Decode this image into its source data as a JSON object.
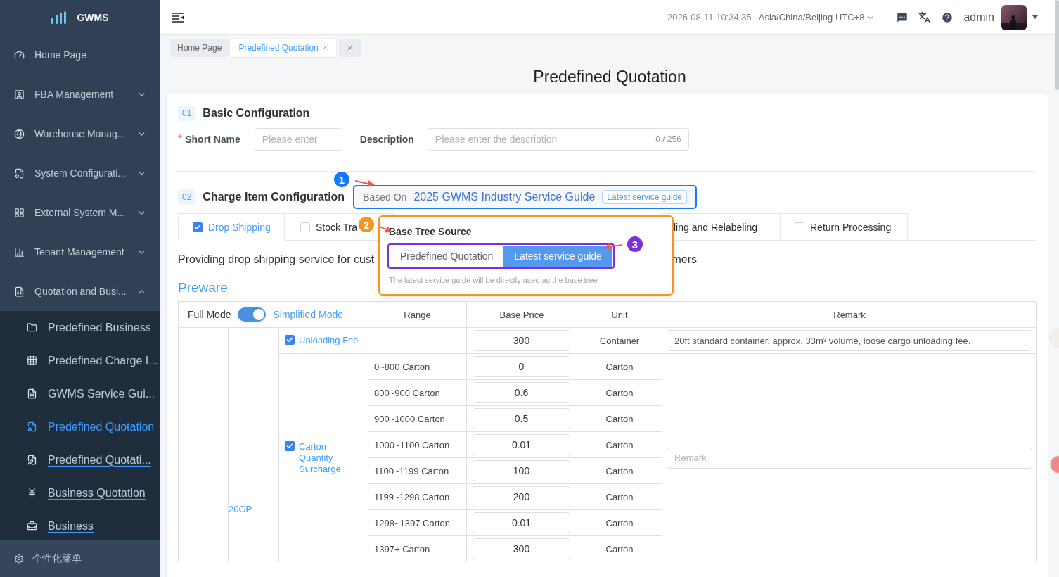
{
  "sidebar": {
    "logo": "GWMS",
    "items": [
      {
        "label": "Home Page",
        "kind": "link"
      },
      {
        "label": "FBA Management",
        "kind": "group",
        "expanded": false
      },
      {
        "label": "Warehouse Manag...",
        "kind": "group",
        "expanded": false
      },
      {
        "label": "System Configurati...",
        "kind": "group",
        "expanded": false
      },
      {
        "label": "External System M...",
        "kind": "group",
        "expanded": false
      },
      {
        "label": "Tenant Management",
        "kind": "group",
        "expanded": false
      },
      {
        "label": "Quotation and Busi...",
        "kind": "group",
        "expanded": true,
        "children": [
          {
            "label": "Predefined Business",
            "selected": false
          },
          {
            "label": "Predefined Charge I...",
            "selected": false
          },
          {
            "label": "GWMS Service Gui...",
            "selected": false
          },
          {
            "label": "Predefined Quotation",
            "selected": true
          },
          {
            "label": "Predefined Quotati...",
            "selected": false
          },
          {
            "label": "Business Quotation",
            "selected": false
          },
          {
            "label": "Business",
            "selected": false
          }
        ]
      }
    ],
    "footer": "个性化菜单"
  },
  "header": {
    "datetime": "2026-08-11 10:34:35",
    "timezone": "Asia/China/Beijing UTC+8",
    "user": "admin"
  },
  "page_tabs": [
    {
      "label": "Home Page",
      "selected": false,
      "closable": false
    },
    {
      "label": "Predefined Quotation",
      "selected": true,
      "closable": true
    }
  ],
  "page_title": "Predefined Quotation",
  "basic": {
    "number": "01",
    "title": "Basic Configuration",
    "short_name": {
      "label": "Short Name",
      "required_mark": "*",
      "placeholder": "Please enter"
    },
    "description": {
      "label": "Description",
      "placeholder": "Please enter the description",
      "counter": "0 / 256"
    }
  },
  "charge": {
    "number": "02",
    "title": "Charge Item Configuration",
    "based_on_label": "Based On",
    "based_on": "2025 GWMS Industry Service Guide",
    "based_on_tag": "Latest service guide",
    "tabs": [
      {
        "label": "Drop Shipping",
        "selected": true,
        "checked": true
      },
      {
        "label": "Stock Tra",
        "selected": false,
        "checked": false
      },
      {
        "label": "ling and Relabeling",
        "selected": false
      },
      {
        "label": "Return Processing",
        "selected": false,
        "checked": false
      }
    ],
    "description_start": "Providing drop shipping service for cust",
    "description_end": "mers",
    "popover": {
      "title": "Base Tree Source",
      "options": [
        {
          "label": "Predefined Quotation",
          "selected": false
        },
        {
          "label": "Latest service guide",
          "selected": true
        }
      ],
      "hint": "The latest service guide will be directly used as the base tree"
    },
    "annotations": [
      "1",
      "2",
      "3"
    ]
  },
  "section": "Preware",
  "table": {
    "mode_left": "Full Mode",
    "mode_right": "Simplified Mode",
    "mode_on": true,
    "columns": [
      "Range",
      "Base Price",
      "Unit",
      "Remark"
    ],
    "container": "20GP",
    "items": [
      {
        "label": "Unloading Fee",
        "checked": true,
        "remark_value": "20ft standard container, approx. 33m³ volume, loose cargo unloading fee.",
        "rows": [
          {
            "price": "300",
            "unit": "Container"
          }
        ]
      },
      {
        "label": "Carton Quantity Surcharge",
        "checked": true,
        "remark_placeholder": "Remark",
        "rows": [
          {
            "range": "0~800 Carton",
            "price": "0",
            "unit": "Carton"
          },
          {
            "range": "800~900 Carton",
            "price": "0.6",
            "unit": "Carton"
          },
          {
            "range": "900~1000 Carton",
            "price": "0.5",
            "unit": "Carton"
          },
          {
            "range": "1000~1100 Carton",
            "price": "0.01",
            "unit": "Carton"
          },
          {
            "range": "1100~1199 Carton",
            "price": "100",
            "unit": "Carton"
          },
          {
            "range": "1199~1298 Carton",
            "price": "200",
            "unit": "Carton"
          },
          {
            "range": "1298~1397 Carton",
            "price": "0.01",
            "unit": "Carton"
          },
          {
            "range": "1397+ Carton",
            "price": "300",
            "unit": "Carton"
          }
        ]
      }
    ]
  }
}
